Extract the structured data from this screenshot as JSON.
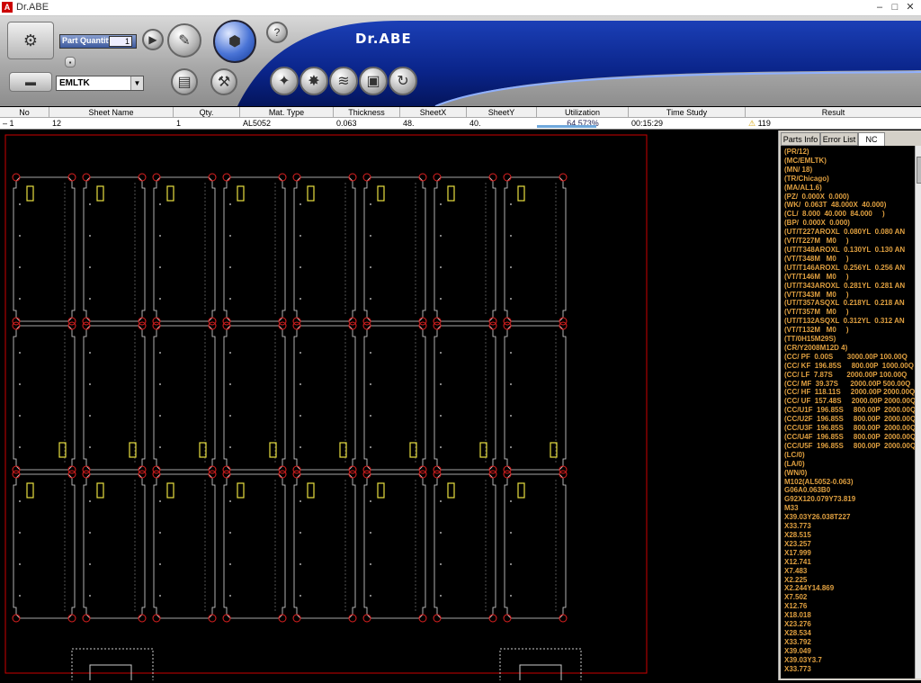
{
  "app": {
    "title": "Dr.ABE",
    "brand": "Dr.ABE"
  },
  "toolbar": {
    "part_quantity_label": "Part Quantity",
    "part_quantity_value": "1",
    "tool_select_value": "EMLTK"
  },
  "grid": {
    "headers": [
      "No",
      "Sheet Name",
      "Qty.",
      "Mat. Type",
      "Thickness",
      "SheetX",
      "SheetY",
      "Utilization",
      "Time Study",
      "Result"
    ],
    "row": {
      "no": "1",
      "sheet_name": "12",
      "qty": "1",
      "mat_type": "AL5052",
      "thickness": "0.063",
      "sheetx": "48.",
      "sheety": "40.",
      "utilization": "64.573%",
      "utilization_fraction": 0.646,
      "time_study": "00:15:29",
      "result": "119"
    }
  },
  "panel": {
    "tabs": [
      "Parts Info",
      "Error List",
      "NC"
    ],
    "active_tab": "NC",
    "nc_lines": [
      "(PR/12)",
      "(MC/EMLTK)",
      "(MN/ 18)",
      "(TR/Chicago)",
      "(MA/AL1.6)",
      "(PZ/  0.000X  0.000)",
      "(WK/  0.063T  48.000X  40.000)",
      "(CL/  8.000  40.000  84.000     )",
      "(BP/  0.000X  0.000)",
      "(UT/T227AROXL  0.080YL  0.080 AN",
      "(VT/T227M   M0     )",
      "(UT/T348AROXL  0.130YL  0.130 AN",
      "(VT/T348M   M0     )",
      "(UT/T146AROXL  0.256YL  0.256 AN",
      "(VT/T146M   M0     )",
      "(UT/T343AROXL  0.281YL  0.281 AN",
      "(VT/T343M   M0     )",
      "(UT/T357ASQXL  0.218YL  0.218 AN",
      "(VT/T357M   M0     )",
      "(UT/T132ASQXL  0.312YL  0.312 AN",
      "(VT/T132M   M0     )",
      "(TT/0H15M29S)",
      "(CR/Y2008M12D 4)",
      "(CC/ PF  0.00S       3000.00P 100.00Q",
      "(CC/ KF  196.85S     800.00P  1000.00Q",
      "(CC/ LF  7.87S       2000.00P 100.00Q",
      "(CC/ MF  39.37S      2000.00P 500.00Q",
      "(CC/ HF  118.11S     2000.00P 2000.00Q",
      "(CC/ UF  157.48S     2000.00P 2000.00Q",
      "(CC/U1F  196.85S     800.00P  2000.00Q",
      "(CC/U2F  196.85S     800.00P  2000.00Q",
      "(CC/U3F  196.85S     800.00P  2000.00Q",
      "(CC/U4F  196.85S     800.00P  2000.00Q",
      "(CC/U5F  196.85S     800.00P  2000.00Q",
      "(LC/0)",
      "(LA/0)",
      "(WN/0)",
      "M102(AL5052-0.063)",
      "G06A0.063B0",
      "G92X120.079Y73.819",
      "M33",
      "X39.03Y26.038T227",
      "X33.773",
      "X28.515",
      "X23.257",
      "X17.999",
      "X12.741",
      "X7.483",
      "X2.225",
      "X2.244Y14.869",
      "X7.502",
      "X12.76",
      "X18.018",
      "X23.276",
      "X28.534",
      "X33.792",
      "X39.049",
      "X39.03Y3.7",
      "X33.773"
    ]
  }
}
